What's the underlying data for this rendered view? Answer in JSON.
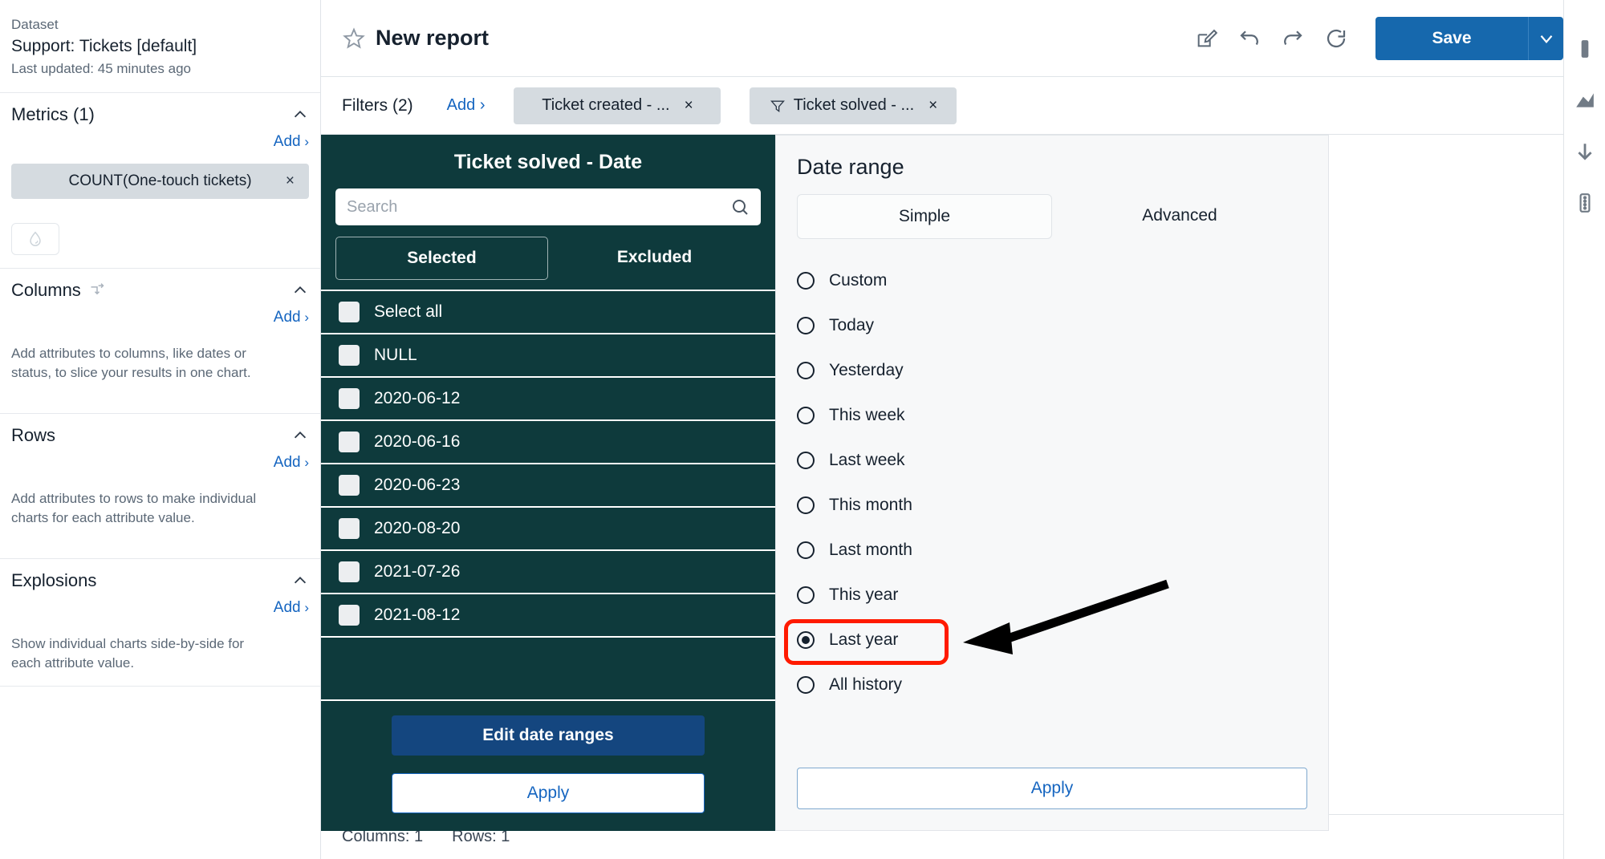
{
  "sidebar": {
    "dataset": {
      "label": "Dataset",
      "name": "Support: Tickets [default]",
      "updated": "Last updated: 45 minutes ago"
    },
    "metrics": {
      "title": "Metrics (1)",
      "add_label": "Add",
      "chips": [
        {
          "label": "COUNT(One-touch tickets)",
          "remove": "×"
        }
      ],
      "droplet_icon": "droplet-icon"
    },
    "columns": {
      "title": "Columns",
      "add_label": "Add",
      "hint": "Add attributes to columns, like dates or status, to slice your results in one chart.",
      "shuffle_icon": "shuffle-icon"
    },
    "rows": {
      "title": "Rows",
      "add_label": "Add",
      "hint": "Add attributes to rows to make individual charts for each attribute value."
    },
    "explosions": {
      "title": "Explosions",
      "add_label": "Add",
      "hint": "Show individual charts side-by-side for each attribute value."
    }
  },
  "topbar": {
    "star_icon": "star-outline-icon",
    "title": "New report",
    "actions": [
      {
        "icon": "edit-square-icon"
      },
      {
        "icon": "undo-icon"
      },
      {
        "icon": "redo-icon"
      },
      {
        "icon": "refresh-icon"
      }
    ],
    "save_label": "Save",
    "save_caret": "chevron-down-icon"
  },
  "filterbar": {
    "label": "Filters (2)",
    "add_label": "Add",
    "chips": [
      {
        "label": "Ticket created - ...",
        "remove": "×",
        "has_funnel": false
      },
      {
        "label": "Ticket solved - ...",
        "remove": "×",
        "has_funnel": true
      }
    ]
  },
  "filter_panel": {
    "title": "Ticket solved - Date",
    "search_placeholder": "Search",
    "search_value": "",
    "tabs": [
      {
        "label": "Selected",
        "active": true
      },
      {
        "label": "Excluded",
        "active": false
      }
    ],
    "rows": [
      {
        "label": "Select all",
        "checked": false
      },
      {
        "label": "NULL",
        "checked": false
      },
      {
        "label": "2020-06-12",
        "checked": false
      },
      {
        "label": "2020-06-16",
        "checked": false
      },
      {
        "label": "2020-06-23",
        "checked": false
      },
      {
        "label": "2020-08-20",
        "checked": false
      },
      {
        "label": "2021-07-26",
        "checked": false
      },
      {
        "label": "2021-08-12",
        "checked": false
      }
    ],
    "edit_ranges_label": "Edit date ranges",
    "apply_label": "Apply"
  },
  "date_range": {
    "title": "Date range",
    "tabs": [
      {
        "label": "Simple",
        "active": true
      },
      {
        "label": "Advanced",
        "active": false
      }
    ],
    "options": [
      {
        "label": "Custom",
        "selected": false
      },
      {
        "label": "Today",
        "selected": false
      },
      {
        "label": "Yesterday",
        "selected": false
      },
      {
        "label": "This week",
        "selected": false
      },
      {
        "label": "Last week",
        "selected": false
      },
      {
        "label": "This month",
        "selected": false
      },
      {
        "label": "Last month",
        "selected": false
      },
      {
        "label": "This year",
        "selected": false
      },
      {
        "label": "Last year",
        "selected": true
      },
      {
        "label": "All history",
        "selected": false
      }
    ],
    "apply_label": "Apply"
  },
  "annotation": {
    "highlight_color": "#ff1a00",
    "arrow_color": "#000000",
    "target_label": "Last year"
  },
  "statusbar": {
    "columns": "Columns: 1",
    "rows": "Rows: 1"
  },
  "right_rail": {
    "icons": [
      "panel-icon",
      "chart-area-icon",
      "download-arrow-icon",
      "list-panel-icon"
    ]
  }
}
